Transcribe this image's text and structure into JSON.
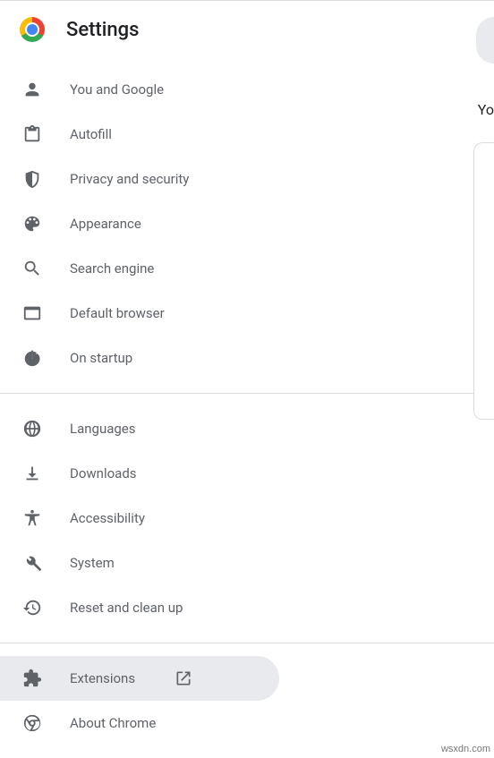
{
  "header": {
    "title": "Settings"
  },
  "sidebar": {
    "group1": [
      {
        "id": "you-and-google",
        "label": "You and Google",
        "icon": "person-icon"
      },
      {
        "id": "autofill",
        "label": "Autofill",
        "icon": "clipboard-icon"
      },
      {
        "id": "privacy-and-security",
        "label": "Privacy and security",
        "icon": "shield-icon"
      },
      {
        "id": "appearance",
        "label": "Appearance",
        "icon": "palette-icon"
      },
      {
        "id": "search-engine",
        "label": "Search engine",
        "icon": "search-icon"
      },
      {
        "id": "default-browser",
        "label": "Default browser",
        "icon": "window-icon"
      },
      {
        "id": "on-startup",
        "label": "On startup",
        "icon": "power-icon"
      }
    ],
    "group2": [
      {
        "id": "languages",
        "label": "Languages",
        "icon": "globe-icon"
      },
      {
        "id": "downloads",
        "label": "Downloads",
        "icon": "download-icon"
      },
      {
        "id": "accessibility",
        "label": "Accessibility",
        "icon": "accessibility-icon"
      },
      {
        "id": "system",
        "label": "System",
        "icon": "wrench-icon"
      },
      {
        "id": "reset-and-clean-up",
        "label": "Reset and clean up",
        "icon": "restore-icon"
      }
    ],
    "group3": [
      {
        "id": "extensions",
        "label": "Extensions",
        "icon": "puzzle-icon",
        "external": true,
        "selected": true
      },
      {
        "id": "about-chrome",
        "label": "About Chrome",
        "icon": "chrome-outline-icon"
      }
    ]
  },
  "peek": {
    "text": "Yo"
  },
  "watermark": "wsxdn.com"
}
